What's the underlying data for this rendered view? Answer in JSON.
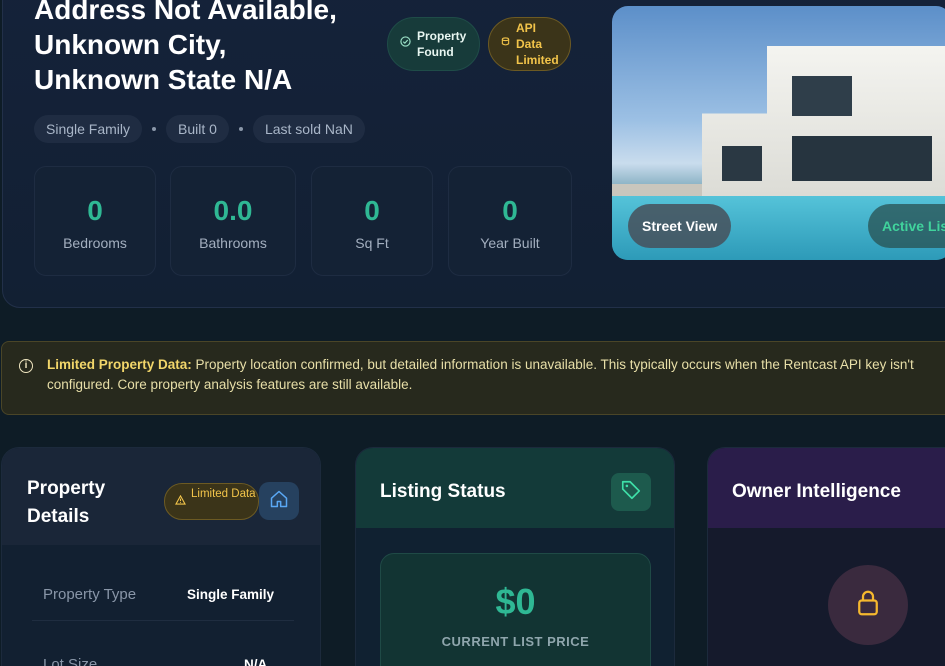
{
  "hero": {
    "address": "Address Not Available,\nUnknown City,\nUnknown State N/A",
    "pill_found": "Property Found",
    "pill_api": "API Data Limited",
    "chips": [
      "Single Family",
      "Built 0",
      "Last sold NaN"
    ],
    "stats": [
      {
        "value": "0",
        "label": "Bedrooms"
      },
      {
        "value": "0.0",
        "label": "Bathrooms"
      },
      {
        "value": "0",
        "label": "Sq Ft"
      },
      {
        "value": "0",
        "label": "Year Built"
      }
    ],
    "street_view": "Street View",
    "active_listing": "Active Listing"
  },
  "banner": {
    "bold": "Limited Property Data:",
    "text": " Property location confirmed, but detailed information is unavailable. This typically occurs when the Rentcast API key isn't configured. Core property analysis features are still available."
  },
  "details": {
    "title": "Property Details",
    "badge": "Limited Data",
    "rows": [
      {
        "label": "Property Type",
        "value": "Single Family"
      },
      {
        "label": "Lot Size",
        "value": "N/A"
      }
    ]
  },
  "listing": {
    "title": "Listing Status",
    "price": "$0",
    "price_label": "CURRENT LIST PRICE"
  },
  "owner": {
    "title": "Owner Intelligence"
  },
  "colors": {
    "accent_green": "#2fb894",
    "warning_yellow": "#f2c44a"
  }
}
